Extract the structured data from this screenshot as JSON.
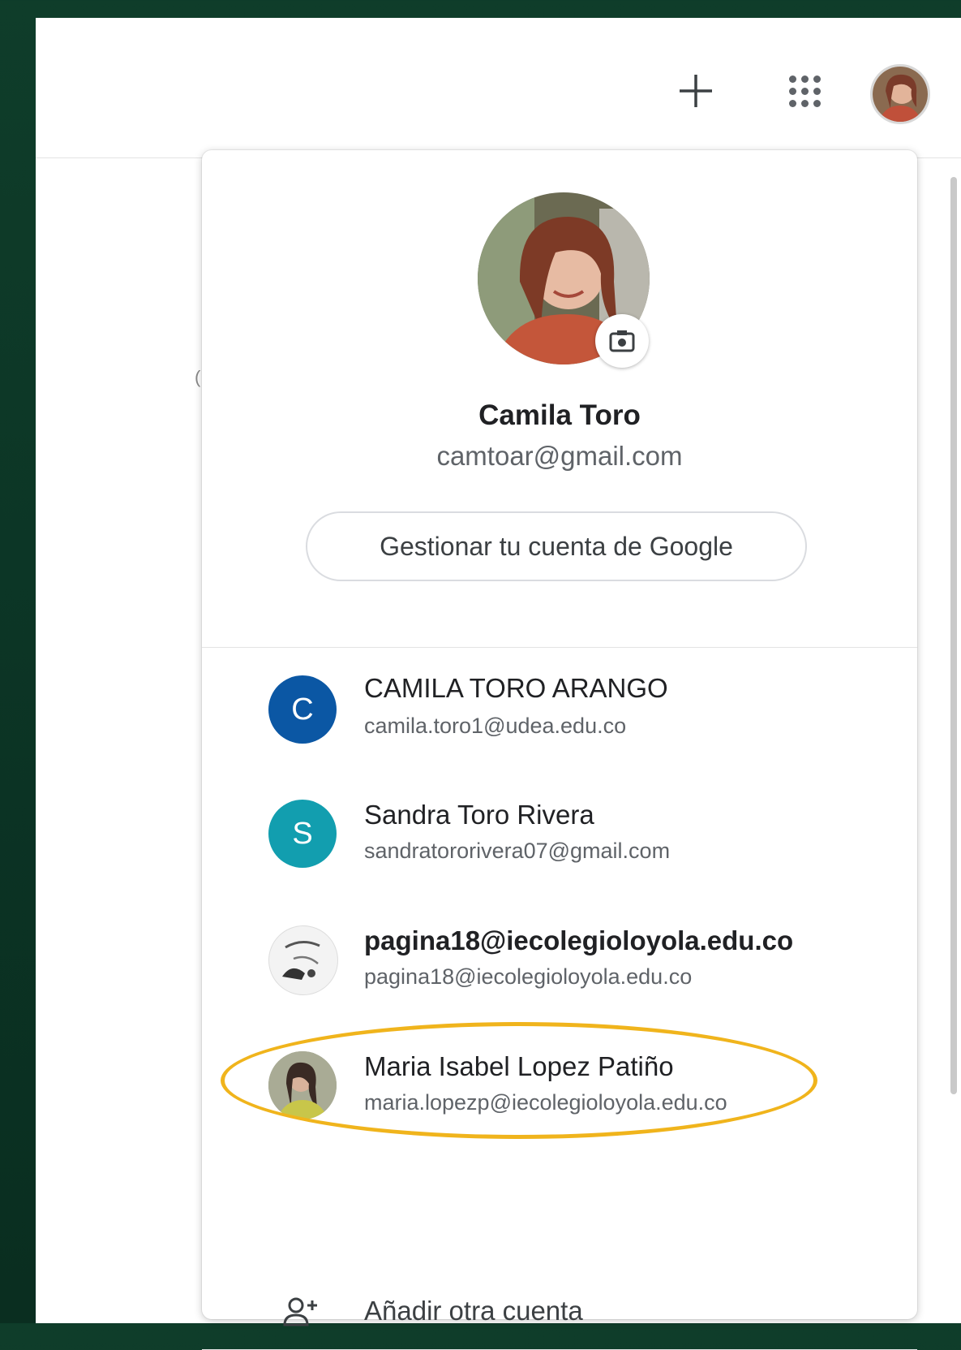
{
  "profile": {
    "name": "Camila Toro",
    "email": "camtoar@gmail.com",
    "manage_label": "Gestionar tu cuenta de Google"
  },
  "accounts": [
    {
      "name": "CAMILA TORO ARANGO",
      "email": "camila.toro1@udea.edu.co",
      "initial": "C",
      "color": "#0b57a4"
    },
    {
      "name": "Sandra Toro Rivera",
      "email": "sandratororivera07@gmail.com",
      "initial": "S",
      "color": "#129eaf"
    },
    {
      "name": "pagina18@iecolegioloyola.edu.co",
      "email": "pagina18@iecolegioloyola.edu.co",
      "icon": "drawing-photo-icon"
    },
    {
      "name": "Maria Isabel Lopez Patiño",
      "email": "maria.lopezp@iecolegioloyola.edu.co",
      "icon": "photo-avatar",
      "highlighted": true
    }
  ],
  "add_account_label": "Añadir otra cuenta",
  "colors": {
    "highlight": "#f0b41c",
    "frame": "#0f3d2a"
  }
}
